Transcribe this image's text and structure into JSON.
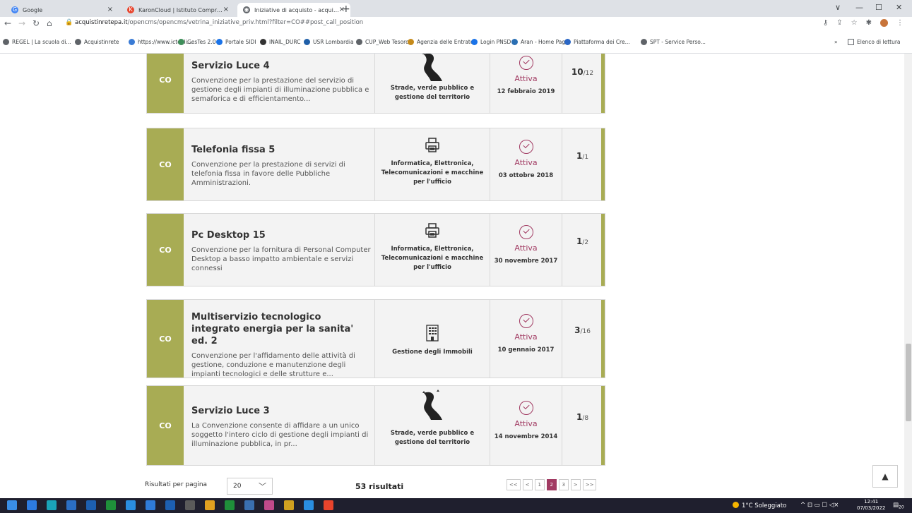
{
  "browser": {
    "tabs": [
      {
        "label": "Google",
        "close": "×",
        "color": "#4285f4",
        "glyph": "G"
      },
      {
        "label": "KaronCloud | Istituto Comprensi",
        "close": "×",
        "color": "#e8442c",
        "glyph": "K"
      },
      {
        "label": "Iniziative di acquisto - acquistinre",
        "close": "×",
        "color": "#5f6368",
        "glyph": "◉"
      }
    ],
    "new_tab": "+",
    "win_min": "—",
    "win_max": "☐",
    "win_close": "✕",
    "win_menu": "∨",
    "url_host": "acquistinretepa.it",
    "url_path": "/opencms/opencms/vetrina_iniziative_priv.html?filter=CO##post_call_position",
    "bookmarks": [
      {
        "label": "REGEL | La scuola di...",
        "color": "#5f6368"
      },
      {
        "label": "Acquistinrete",
        "color": "#5f6368"
      },
      {
        "label": "https://www.ictegli...",
        "color": "#3a7bd5"
      },
      {
        "label": "GesTes 2.0",
        "color": "#3f8f5a"
      },
      {
        "label": "Portale SIDI",
        "color": "#1a73e8"
      },
      {
        "label": "INAIL_DURC",
        "color": "#333"
      },
      {
        "label": "USR Lombardia",
        "color": "#1f5fa8"
      },
      {
        "label": "CUP_Web Tesoro",
        "color": "#5f6368"
      },
      {
        "label": "Agenzia delle Entrate",
        "color": "#c58a1a"
      },
      {
        "label": "Login PNSD",
        "color": "#1a73e8"
      },
      {
        "label": "Aran - Home Page",
        "color": "#2a6fb3"
      },
      {
        "label": "Piattaforma dei Cre...",
        "color": "#2a66c4"
      },
      {
        "label": "SPT - Service Perso...",
        "color": "#5f6368"
      }
    ],
    "more_bookmarks": "»",
    "reading_list": "Elenco di lettura"
  },
  "cards": [
    {
      "type": "CO",
      "title": "Servizio Luce 4",
      "description": "Convenzione per la prestazione del servizio di gestione degli impianti di illuminazione pubblica e semaforica e di efficientamento...",
      "category": "Strade, verde pubblico e gestione del territorio",
      "icon": "road-icon",
      "status": "Attiva",
      "date": "12 febbraio 2019",
      "count": "10",
      "total": "/12"
    },
    {
      "type": "CO",
      "title": "Telefonia fissa 5",
      "description": "Convenzione per la prestazione di servizi di telefonia fissa in favore delle Pubbliche Amministrazioni.",
      "category": "Informatica, Elettronica, Telecomunicazioni e macchine per l'ufficio",
      "icon": "printer-icon",
      "status": "Attiva",
      "date": "03 ottobre 2018",
      "count": "1",
      "total": "/1"
    },
    {
      "type": "CO",
      "title": "Pc Desktop 15",
      "description": "Convenzione per la fornitura di Personal Computer Desktop a basso impatto ambientale e servizi connessi",
      "category": "Informatica, Elettronica, Telecomunicazioni e macchine per l'ufficio",
      "icon": "printer-icon",
      "status": "Attiva",
      "date": "30 novembre 2017",
      "count": "1",
      "total": "/2"
    },
    {
      "type": "CO",
      "title": "Multiservizio tecnologico integrato energia per la sanita' ed. 2",
      "description": "Convenzione per l'affidamento delle attività di gestione, conduzione e manutenzione degli impianti tecnologici e delle strutture e...",
      "category": "Gestione degli Immobili",
      "icon": "building-icon",
      "status": "Attiva",
      "date": "10 gennaio 2017",
      "count": "3",
      "total": "/16"
    },
    {
      "type": "CO",
      "title": "Servizio Luce 3",
      "description": "La Convenzione consente di affidare a un unico soggetto l'intero ciclo di gestione degli impianti di illuminazione pubblica, in pr...",
      "category": "Strade, verde pubblico e gestione del territorio",
      "icon": "road-icon",
      "status": "Attiva",
      "date": "14 novembre 2014",
      "count": "1",
      "total": "/8"
    }
  ],
  "footer": {
    "per_page_label": "Risultati per pagina",
    "per_page_value": "20",
    "results": "53 risultati",
    "pages": [
      "<<",
      "<",
      "1",
      "2",
      "3",
      ">",
      ">>"
    ],
    "current_page": "2"
  },
  "taskbar": {
    "weather": "1°C Soleggiato",
    "time": "12:41",
    "date": "07/03/2022",
    "notif": "20"
  },
  "colors": {
    "accent": "#a8ac54",
    "status": "#a13a62"
  }
}
